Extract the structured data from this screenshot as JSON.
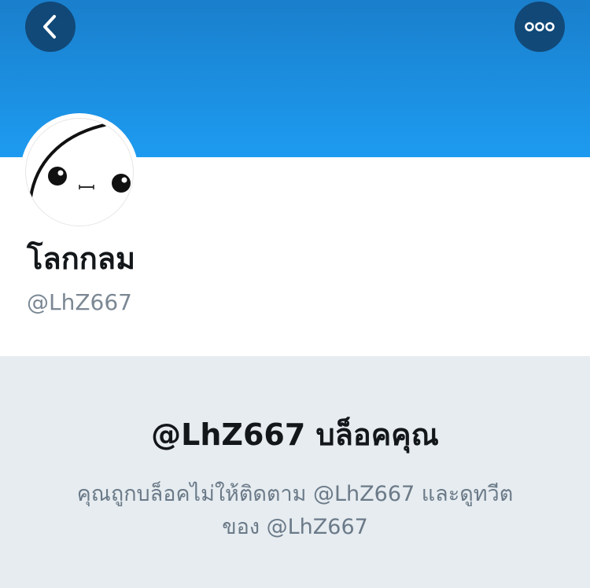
{
  "header": {
    "back_icon": "chevron-left-icon",
    "more_icon": "ellipsis-horizontal-icon",
    "banner_color": "#1d9bf0"
  },
  "profile": {
    "display_name": "โลกกลม",
    "handle": "@LhZ667",
    "avatar_icon": "cute-face-avatar"
  },
  "blocked": {
    "title": "@LhZ667 บล็อคคุณ",
    "message": "คุณถูกบล็อคไม่ให้ติดตาม @LhZ667 และดูทวีตของ @LhZ667"
  },
  "colors": {
    "text_primary": "#14171a",
    "text_secondary": "#7b8894",
    "blocked_background": "#e6ecf0"
  }
}
